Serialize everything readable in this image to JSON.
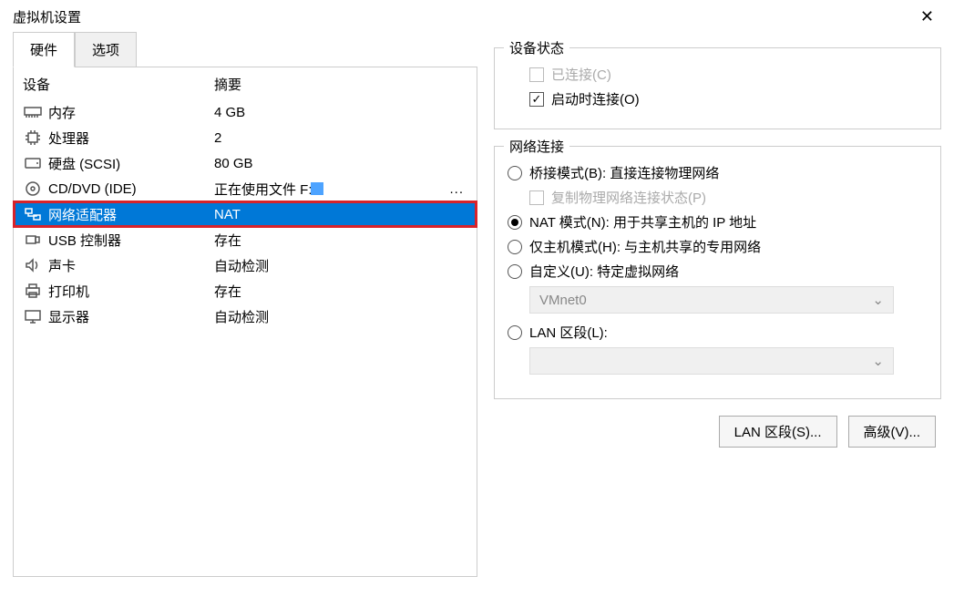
{
  "title": "虚拟机设置",
  "tabs": {
    "hardware": "硬件",
    "options": "选项"
  },
  "columns": {
    "device": "设备",
    "summary": "摘要"
  },
  "devices": [
    {
      "icon": "memory",
      "name": "内存",
      "summary": "4 GB"
    },
    {
      "icon": "cpu",
      "name": "处理器",
      "summary": "2"
    },
    {
      "icon": "disk",
      "name": "硬盘 (SCSI)",
      "summary": "80 GB"
    },
    {
      "icon": "disc",
      "name": "CD/DVD (IDE)",
      "summary": "正在使用文件 F:",
      "hasChip": true,
      "hasEllipsis": true
    },
    {
      "icon": "network",
      "name": "网络适配器",
      "summary": "NAT",
      "selected": true,
      "highlighted": true
    },
    {
      "icon": "usb",
      "name": "USB 控制器",
      "summary": "存在"
    },
    {
      "icon": "sound",
      "name": "声卡",
      "summary": "自动检测"
    },
    {
      "icon": "printer",
      "name": "打印机",
      "summary": "存在"
    },
    {
      "icon": "display",
      "name": "显示器",
      "summary": "自动检测"
    }
  ],
  "device_state": {
    "legend": "设备状态",
    "connected": "已连接(C)",
    "connect_on_start": "启动时连接(O)"
  },
  "network": {
    "legend": "网络连接",
    "bridged": "桥接模式(B): 直接连接物理网络",
    "replicate": "复制物理网络连接状态(P)",
    "nat": "NAT 模式(N): 用于共享主机的 IP 地址",
    "hostonly": "仅主机模式(H): 与主机共享的专用网络",
    "custom": "自定义(U): 特定虚拟网络",
    "vmnet": "VMnet0",
    "lan": "LAN 区段(L):"
  },
  "buttons": {
    "lan_seg": "LAN 区段(S)...",
    "advanced": "高级(V)..."
  }
}
